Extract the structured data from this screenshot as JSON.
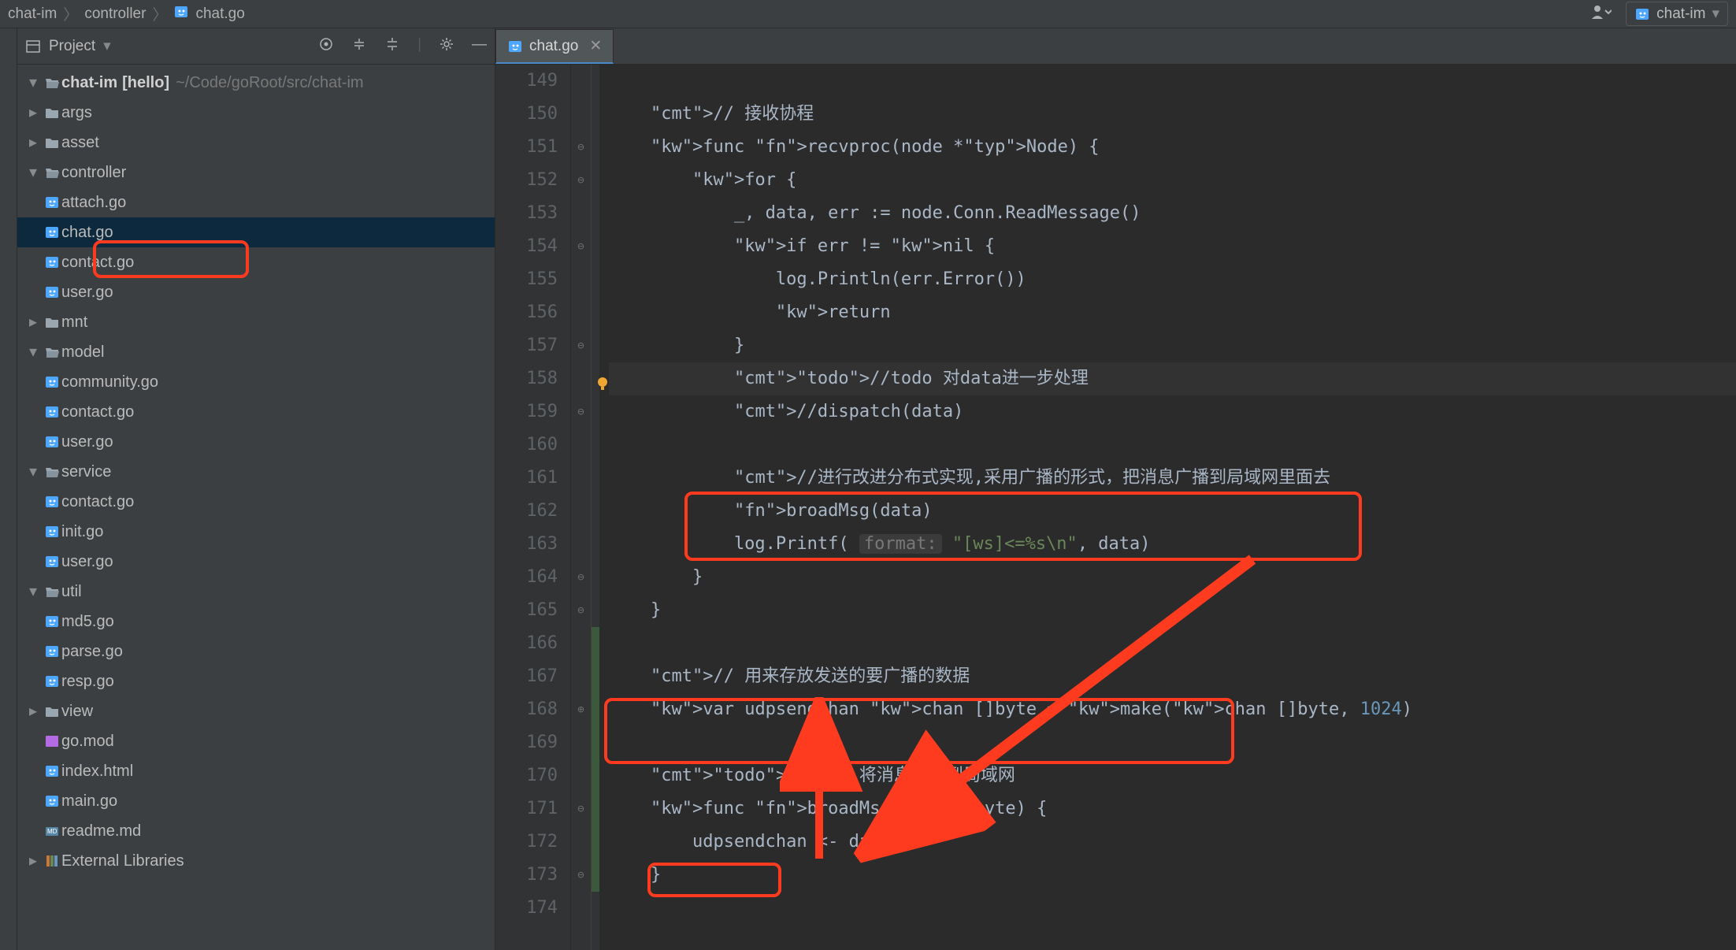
{
  "breadcrumb": {
    "items": [
      "chat-im",
      "controller",
      "chat.go"
    ]
  },
  "topRight": {
    "runConfig": "chat-im"
  },
  "sidebar": {
    "headerTitle": "Project",
    "tree": {
      "project": {
        "name": "chat-im",
        "tag": "[hello]",
        "path": "~/Code/goRoot/src/chat-im"
      },
      "folders": {
        "args": "args",
        "asset": "asset",
        "controller": "controller",
        "mnt": "mnt",
        "model": "model",
        "service": "service",
        "util": "util",
        "view": "view"
      },
      "controllerFiles": [
        "attach.go",
        "chat.go",
        "contact.go",
        "user.go"
      ],
      "modelFiles": [
        "community.go",
        "contact.go",
        "user.go"
      ],
      "serviceFiles": [
        "contact.go",
        "init.go",
        "user.go"
      ],
      "utilFiles": [
        "md5.go",
        "parse.go",
        "resp.go"
      ],
      "rootFiles": {
        "gomod": "go.mod",
        "index": "index.html",
        "main": "main.go",
        "readme": "readme.md"
      },
      "external": "External Libraries"
    }
  },
  "editor": {
    "tabName": "chat.go",
    "startLine": 149,
    "lines": [
      "",
      "    // 接收协程",
      "    func recvproc(node *Node) {",
      "        for {",
      "            _, data, err := node.Conn.ReadMessage()",
      "            if err != nil {",
      "                log.Println(err.Error())",
      "                return",
      "            }",
      "            //todo 对data进一步处理",
      "            //dispatch(data)",
      "",
      "            //进行改进分布式实现,采用广播的形式，把消息广播到局域网里面去",
      "            broadMsg(data)",
      "            log.Printf( format: \"[ws]<=%s\\n\", data)",
      "        }",
      "    }",
      "",
      "    // 用来存放发送的要广播的数据",
      "    var udpsendchan chan []byte = make(chan []byte, 1024)",
      "",
      "    // todo 将消息广播到局域网",
      "    func broadMsg(data []byte) {",
      "        udpsendchan <- data",
      "    }",
      ""
    ]
  }
}
